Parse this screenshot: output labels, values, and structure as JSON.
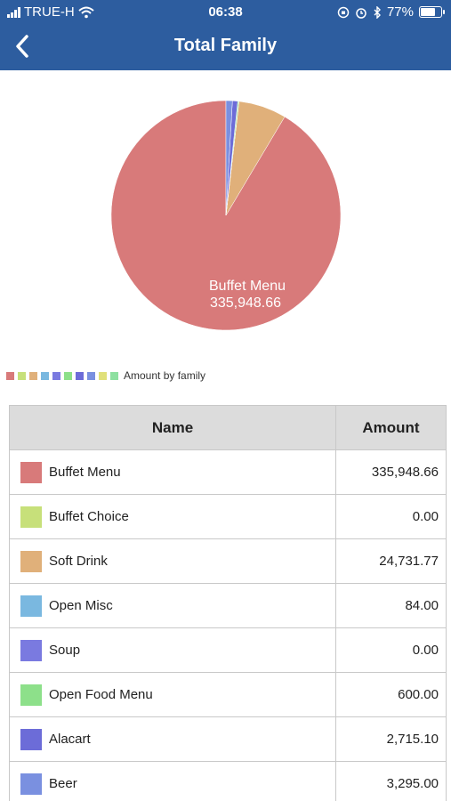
{
  "status_bar": {
    "carrier": "TRUE-H",
    "time": "06:38",
    "battery": "77%",
    "battery_level": 0.77
  },
  "header": {
    "title": "Total Family"
  },
  "chart_data": {
    "type": "pie",
    "slice_label": {
      "name": "Buffet Menu",
      "value": "335,948.66"
    },
    "legend_label": "Amount by family",
    "slices": [
      {
        "name": "Buffet Menu",
        "value": 335948.66,
        "color": "#d87a7a"
      },
      {
        "name": "Buffet Choice",
        "value": 0.0,
        "color": "#c7e07a"
      },
      {
        "name": "Soft Drink",
        "value": 24731.77,
        "color": "#e0b07a"
      },
      {
        "name": "Open Misc",
        "value": 84.0,
        "color": "#7ab8e0"
      },
      {
        "name": "Soup",
        "value": 0.0,
        "color": "#7a7ae0"
      },
      {
        "name": "Open Food Menu",
        "value": 600.0,
        "color": "#8de08a"
      },
      {
        "name": "Alacart",
        "value": 2715.1,
        "color": "#6c6cd8"
      },
      {
        "name": "Beer",
        "value": 3295.0,
        "color": "#7a90e0"
      }
    ],
    "legend_colors": [
      "#d87a7a",
      "#c7e07a",
      "#e0b07a",
      "#7ab8e0",
      "#7a7ae0",
      "#8de08a",
      "#6c6cd8",
      "#7a90e0",
      "#e0e07a",
      "#8de0a0"
    ]
  },
  "table": {
    "columns": [
      "Name",
      "Amount"
    ],
    "rows": [
      {
        "name": "Buffet Menu",
        "amount": "335,948.66",
        "color": "#d87a7a"
      },
      {
        "name": "Buffet Choice",
        "amount": "0.00",
        "color": "#c7e07a"
      },
      {
        "name": "Soft Drink",
        "amount": "24,731.77",
        "color": "#e0b07a"
      },
      {
        "name": "Open Misc",
        "amount": "84.00",
        "color": "#7ab8e0"
      },
      {
        "name": "Soup",
        "amount": "0.00",
        "color": "#7a7ae0"
      },
      {
        "name": "Open Food Menu",
        "amount": "600.00",
        "color": "#8de08a"
      },
      {
        "name": "Alacart",
        "amount": "2,715.10",
        "color": "#6c6cd8"
      },
      {
        "name": "Beer",
        "amount": "3,295.00",
        "color": "#7a90e0"
      }
    ]
  }
}
